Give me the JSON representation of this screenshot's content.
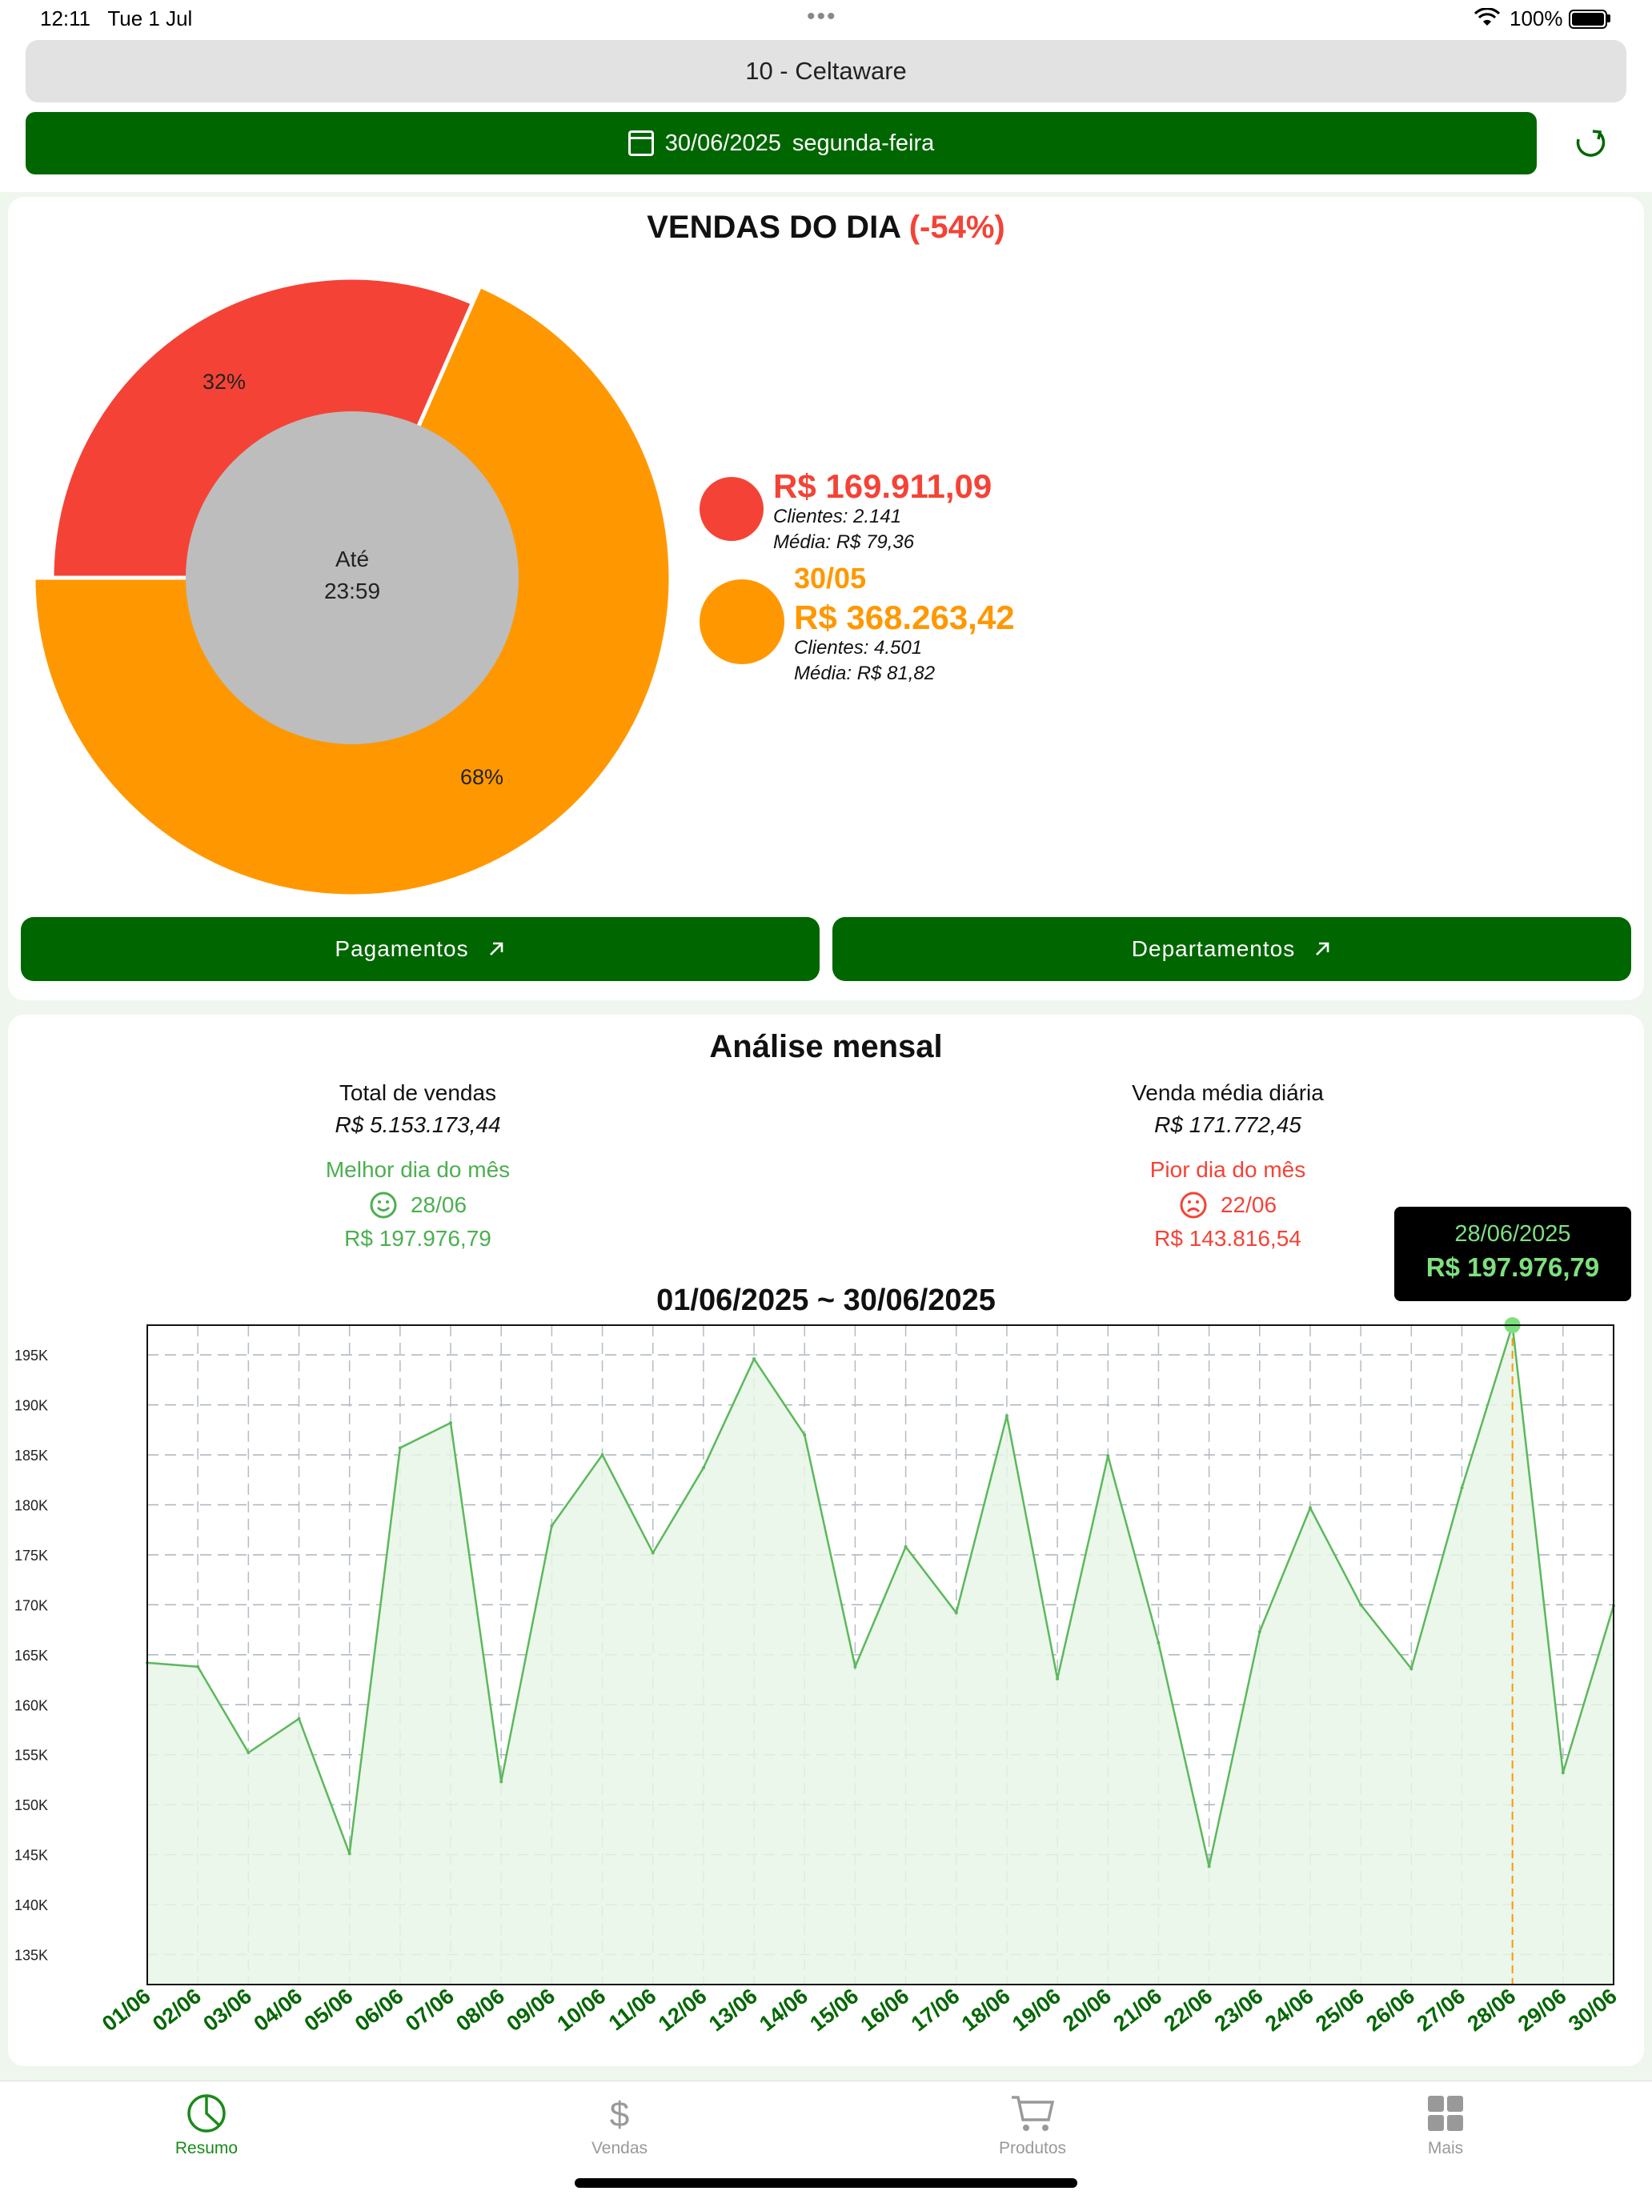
{
  "status": {
    "time": "12:11",
    "date": "Tue 1 Jul",
    "battery": "100%"
  },
  "company": "10 - Celtaware",
  "datebar": {
    "date": "30/06/2025",
    "weekday": "segunda-feira"
  },
  "sales_day": {
    "title": "VENDAS DO DIA",
    "change": "(-54%)",
    "center_line1": "Até",
    "center_line2": "23:59",
    "slice_current_pct": "32%",
    "slice_previous_pct": "68%",
    "current": {
      "value": "R$ 169.911,09",
      "clients": "Clientes: 2.141",
      "avg": "Média: R$ 79,36"
    },
    "previous": {
      "date": "30/05",
      "value": "R$ 368.263,42",
      "clients": "Clientes: 4.501",
      "avg": "Média: R$ 81,82"
    },
    "buttons": {
      "payments": "Pagamentos",
      "departments": "Departamentos"
    }
  },
  "monthly": {
    "title": "Análise mensal",
    "total_label": "Total de vendas",
    "total_value": "R$ 5.153.173,44",
    "avg_label": "Venda média diária",
    "avg_value": "R$ 171.772,45",
    "best_label": "Melhor dia do mês",
    "best_day": "28/06",
    "best_value": "R$ 197.976,79",
    "worst_label": "Pior dia do mês",
    "worst_day": "22/06",
    "worst_value": "R$ 143.816,54",
    "range": "01/06/2025 ~ 30/06/2025",
    "tooltip_date": "28/06/2025",
    "tooltip_value": "R$ 197.976,79"
  },
  "chart_data": [
    {
      "type": "pie",
      "categories": [
        "30/06",
        "30/05"
      ],
      "values": [
        169911.09,
        368263.42
      ],
      "labels": [
        "32%",
        "68%"
      ],
      "colors": [
        "#f44336",
        "#ff9800"
      ]
    },
    {
      "type": "area",
      "x": [
        "01/06",
        "02/06",
        "03/06",
        "04/06",
        "05/06",
        "06/06",
        "07/06",
        "08/06",
        "09/06",
        "10/06",
        "11/06",
        "12/06",
        "13/06",
        "14/06",
        "15/06",
        "16/06",
        "17/06",
        "18/06",
        "19/06",
        "20/06",
        "21/06",
        "22/06",
        "23/06",
        "24/06",
        "25/06",
        "26/06",
        "27/06",
        "28/06",
        "29/06",
        "30/06"
      ],
      "series": [
        {
          "values": [
            164200,
            163800,
            155200,
            158600,
            145100,
            185700,
            188200,
            152300,
            177900,
            185000,
            175200,
            183700,
            194600,
            187000,
            163800,
            175800,
            169200,
            188900,
            162600,
            184900,
            166200,
            143816.54,
            167300,
            179700,
            170000,
            163600,
            181700,
            197976.79,
            153200,
            169911.09
          ]
        }
      ],
      "ylim": [
        132000,
        197976.79
      ],
      "yticks": [
        "195K",
        "190K",
        "185K",
        "180K",
        "175K",
        "170K",
        "165K",
        "160K",
        "155K",
        "150K",
        "145K",
        "140K",
        "135K"
      ],
      "ytick_values": [
        195000,
        190000,
        185000,
        180000,
        175000,
        170000,
        165000,
        160000,
        155000,
        150000,
        145000,
        140000,
        135000
      ],
      "highlight_index": 27,
      "line_color": "#5cb85c",
      "fill_color": "#e6f6e6",
      "xlabel_color": "#006600",
      "grid": true
    }
  ],
  "tabs": [
    {
      "label": "Resumo"
    },
    {
      "label": "Vendas"
    },
    {
      "label": "Produtos"
    },
    {
      "label": "Mais"
    }
  ]
}
